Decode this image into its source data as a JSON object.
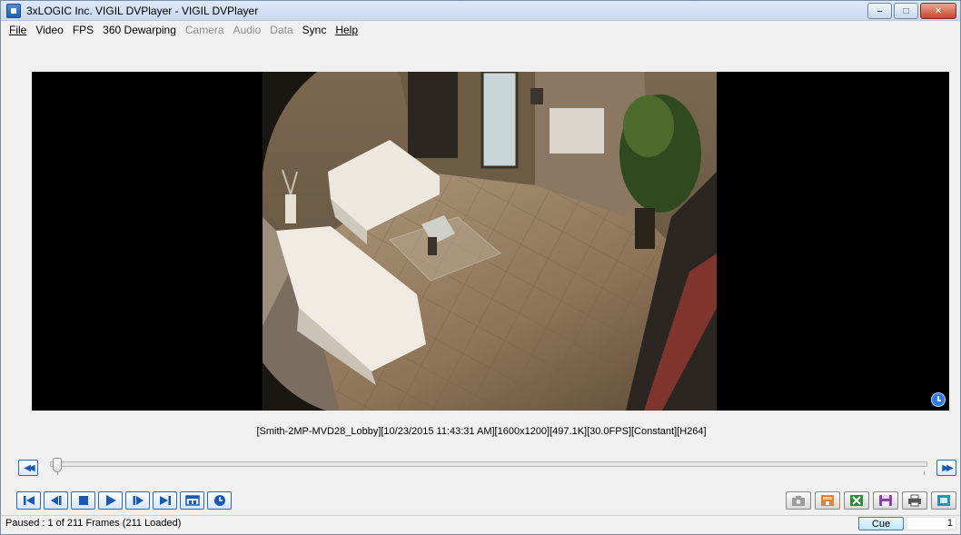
{
  "window": {
    "title": "3xLOGIC Inc. VIGIL DVPlayer - VIGIL DVPlayer",
    "minimize": "–",
    "maximize": "□",
    "close": "✕"
  },
  "menu": [
    {
      "label": "File",
      "underlined": true,
      "enabled": true
    },
    {
      "label": "Video",
      "enabled": true
    },
    {
      "label": "FPS",
      "enabled": true
    },
    {
      "label": "360 Dewarping",
      "enabled": true
    },
    {
      "label": "Camera",
      "enabled": false
    },
    {
      "label": "Audio",
      "enabled": false
    },
    {
      "label": "Data",
      "enabled": false
    },
    {
      "label": "Sync",
      "enabled": true
    },
    {
      "label": "Help",
      "underlined": true,
      "enabled": true
    }
  ],
  "video": {
    "info": "[Smith-2MP-MVD28_Lobby][10/23/2015 11:43:31 AM][1600x1200][497.1K][30.0FPS][Constant][H264]",
    "scene": "lobby-camera-frame"
  },
  "timeline": {
    "rewind_icon": "fast-rewind-icon",
    "forward_icon": "fast-forward-icon",
    "position": 0.0
  },
  "transport": [
    "skip-to-start-icon",
    "step-back-icon",
    "stop-icon",
    "play-icon",
    "step-forward-icon",
    "skip-to-end-icon",
    "screen-layout-icon",
    "clock-icon"
  ],
  "tools": [
    "snapshot-icon",
    "export-icon",
    "excel-export-icon",
    "save-icon",
    "print-icon",
    "fullscreen-icon"
  ],
  "status": {
    "text": "Paused : 1 of 211 Frames (211 Loaded)",
    "cue_label": "Cue",
    "cue_value": "1"
  },
  "colors": {
    "accent": "#1a58b8",
    "frame_bg": "#000000"
  }
}
